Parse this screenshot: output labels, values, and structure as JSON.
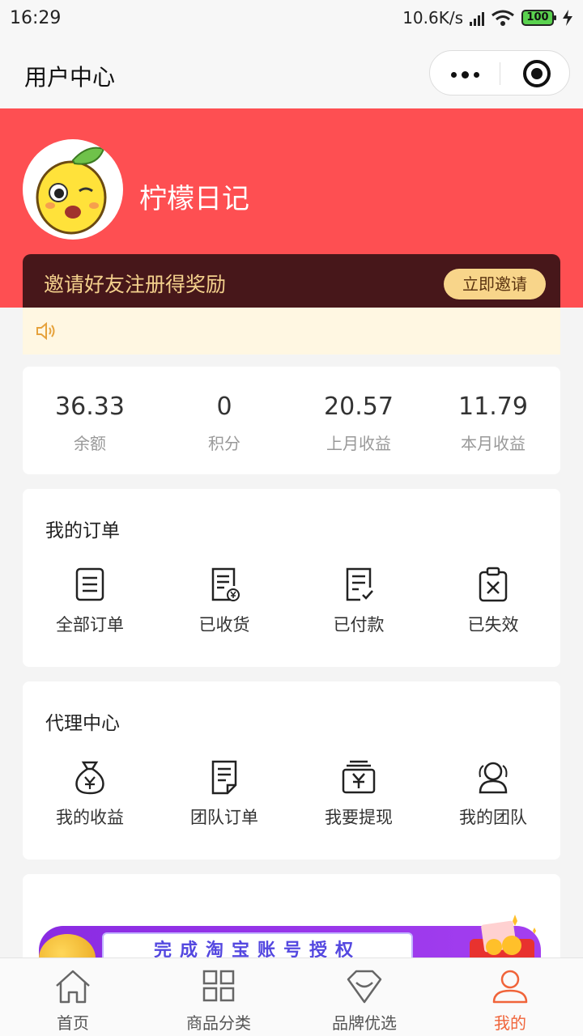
{
  "status_bar": {
    "time": "16:29",
    "speed": "10.6K/s",
    "battery": "100"
  },
  "navbar": {
    "title": "用户中心"
  },
  "profile": {
    "username": "柠檬日记"
  },
  "invite": {
    "text": "邀请好友注册得奖励",
    "button": "立即邀请"
  },
  "stats": [
    {
      "value": "36.33",
      "label": "余额"
    },
    {
      "value": "0",
      "label": "积分"
    },
    {
      "value": "20.57",
      "label": "上月收益"
    },
    {
      "value": "11.79",
      "label": "本月收益"
    }
  ],
  "orders": {
    "title": "我的订单",
    "items": [
      {
        "label": "全部订单",
        "icon": "document-icon"
      },
      {
        "label": "已收货",
        "icon": "receipt-yen-icon"
      },
      {
        "label": "已付款",
        "icon": "document-check-icon"
      },
      {
        "label": "已失效",
        "icon": "clipboard-x-icon"
      }
    ]
  },
  "agent": {
    "title": "代理中心",
    "items": [
      {
        "label": "我的收益",
        "icon": "money-bag-icon"
      },
      {
        "label": "团队订单",
        "icon": "list-document-icon"
      },
      {
        "label": "我要提现",
        "icon": "cash-stack-icon"
      },
      {
        "label": "我的团队",
        "icon": "team-icon"
      }
    ]
  },
  "banner": {
    "text": "完成淘宝账号授权"
  },
  "tabbar": [
    {
      "label": "首页",
      "icon": "home-icon"
    },
    {
      "label": "商品分类",
      "icon": "grid-icon"
    },
    {
      "label": "品牌优选",
      "icon": "diamond-icon"
    },
    {
      "label": "我的",
      "icon": "user-icon",
      "active": true
    }
  ],
  "colors": {
    "primary_red": "#fe4f52",
    "invite_bg": "#47171a",
    "gold": "#f8d58a",
    "tab_active": "#f0643a"
  }
}
